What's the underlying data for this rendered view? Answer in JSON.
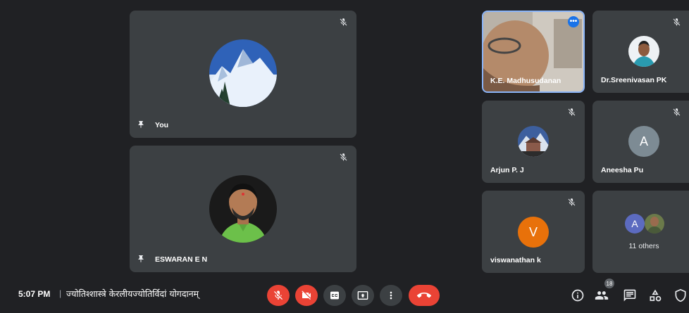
{
  "participants": {
    "you": {
      "name": "You"
    },
    "eswaran": {
      "name": "ESWARAN E N"
    },
    "madhusudanan": {
      "name": "K.E. Madhusudanan"
    },
    "sreenivasan": {
      "name": "Dr.Sreenivasan PK"
    },
    "arjun": {
      "name": "Arjun P. J"
    },
    "aneesha": {
      "name": "Aneesha Pu",
      "initial": "A",
      "color": "#7d8b94"
    },
    "viswanathan": {
      "name": "viswanathan k",
      "initial": "V",
      "color": "#e8710a"
    },
    "others": {
      "label": "11 others",
      "initial": "A",
      "color": "#5c6bc0"
    }
  },
  "bottom_bar": {
    "time": "5:07 PM",
    "separator": "|",
    "meeting_title": "ज्योतिश्शास्त्रे केरलीयज्योतिर्विदां योगदानम्",
    "participant_count": "18"
  },
  "colors": {
    "background": "#202124",
    "tile": "#3c4043",
    "danger": "#ea4335",
    "highlight": "#8ab4f8"
  }
}
